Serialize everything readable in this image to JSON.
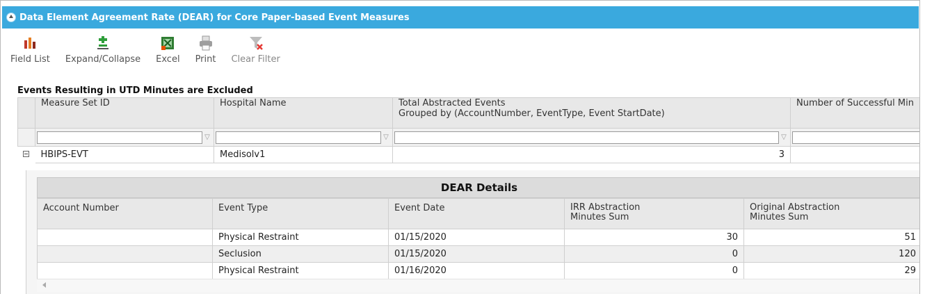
{
  "panel": {
    "title": "Data Element Agreement Rate (DEAR) for Core Paper-based Event Measures"
  },
  "toolbar": {
    "items": [
      {
        "label": "Field List",
        "icon": "field-list-icon"
      },
      {
        "label": "Expand/Collapse",
        "icon": "expand-collapse-icon"
      },
      {
        "label": "Excel",
        "icon": "excel-icon"
      },
      {
        "label": "Print",
        "icon": "print-icon"
      },
      {
        "label": "Clear Filter",
        "icon": "clear-filter-icon"
      }
    ]
  },
  "caption": "Events Resulting in UTD Minutes are Excluded",
  "main_grid": {
    "headers": {
      "measure_set_id": "Measure Set ID",
      "hospital_name": "Hospital Name",
      "total_events_line1": "Total Abstracted Events",
      "total_events_line2": "Grouped by (AccountNumber, EventType, Event StartDate)",
      "successful": "Number of Successful Min"
    },
    "row": {
      "measure_set_id": "HBIPS-EVT",
      "hospital_name": "Medisolv1",
      "total_events": "3"
    }
  },
  "detail": {
    "title": "DEAR Details",
    "headers": {
      "account_number": "Account Number",
      "event_type": "Event Type",
      "event_date": "Event Date",
      "irr_line1": "IRR Abstraction",
      "irr_line2": "Minutes Sum",
      "orig_line1": "Original Abstraction",
      "orig_line2": "Minutes Sum"
    },
    "rows": [
      {
        "account_number": "",
        "event_type": "Physical Restraint",
        "event_date": "01/15/2020",
        "irr": "30",
        "orig": "51"
      },
      {
        "account_number": "",
        "event_type": "Seclusion",
        "event_date": "01/15/2020",
        "irr": "0",
        "orig": "120"
      },
      {
        "account_number": "",
        "event_type": "Physical Restraint",
        "event_date": "01/16/2020",
        "irr": "0",
        "orig": "29"
      }
    ]
  },
  "colors": {
    "header_blue": "#3aa9de",
    "grid_header": "#e8e8e8",
    "row_alt": "#efefef"
  }
}
